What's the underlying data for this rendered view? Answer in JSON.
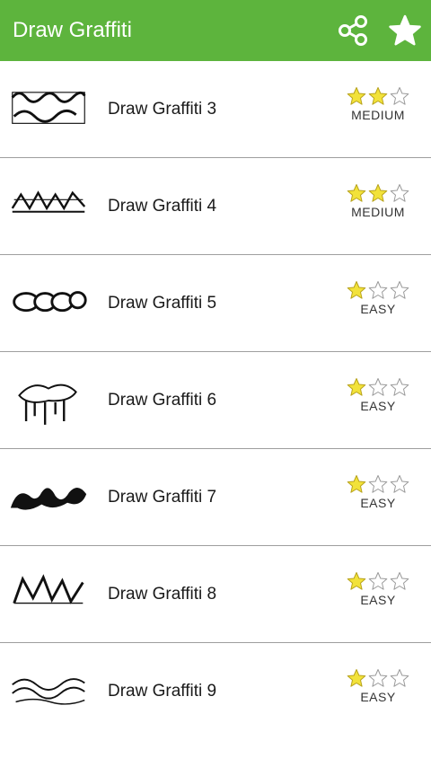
{
  "app": {
    "title": "Draw Graffiti",
    "bar_color": "#5db43d",
    "actions": [
      {
        "name": "share",
        "icon": "share-icon"
      },
      {
        "name": "favorite",
        "icon": "star-icon"
      }
    ]
  },
  "colors": {
    "star_filled": "#f2e23a",
    "star_outline": "#9a9a9a"
  },
  "items": [
    {
      "title": "Draw Graffiti 3",
      "difficulty": "MEDIUM",
      "stars": 2,
      "max_stars": 3,
      "thumb": "graffiti-thumbnail"
    },
    {
      "title": "Draw Graffiti 4",
      "difficulty": "MEDIUM",
      "stars": 2,
      "max_stars": 3,
      "thumb": "graffiti-thumbnail"
    },
    {
      "title": "Draw Graffiti 5",
      "difficulty": "EASY",
      "stars": 1,
      "max_stars": 3,
      "thumb": "graffiti-thumbnail"
    },
    {
      "title": "Draw Graffiti 6",
      "difficulty": "EASY",
      "stars": 1,
      "max_stars": 3,
      "thumb": "graffiti-thumbnail"
    },
    {
      "title": "Draw Graffiti 7",
      "difficulty": "EASY",
      "stars": 1,
      "max_stars": 3,
      "thumb": "graffiti-thumbnail"
    },
    {
      "title": "Draw Graffiti 8",
      "difficulty": "EASY",
      "stars": 1,
      "max_stars": 3,
      "thumb": "graffiti-thumbnail"
    },
    {
      "title": "Draw Graffiti 9",
      "difficulty": "EASY",
      "stars": 1,
      "max_stars": 3,
      "thumb": "graffiti-thumbnail"
    }
  ]
}
